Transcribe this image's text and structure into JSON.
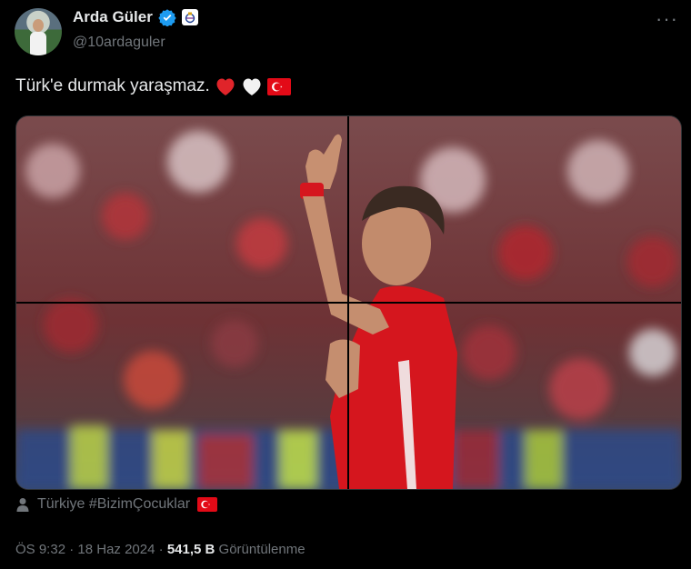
{
  "author": {
    "display_name": "Arda Güler",
    "handle": "@10ardaguler",
    "verified": true
  },
  "tweet": {
    "text": "Türk'e durmak yaraşmaz.",
    "emojis": [
      "red-heart",
      "white-heart",
      "turkey-flag"
    ]
  },
  "media": {
    "grid_lines": "2x2"
  },
  "location": {
    "text": "Türkiye #BizimÇocuklar",
    "flag": "turkey-flag"
  },
  "meta": {
    "time": "ÖS 9:32",
    "separator1": " · ",
    "date": "18 Haz 2024",
    "separator2": " · ",
    "views_count": "541,5 B",
    "views_label": " Görüntülenme"
  },
  "menu": {
    "more_label": "···"
  },
  "colors": {
    "background": "#000000",
    "text": "#e7e9ea",
    "muted": "#71767b",
    "verified": "#1d9bf0",
    "flag_red": "#e30a17"
  }
}
